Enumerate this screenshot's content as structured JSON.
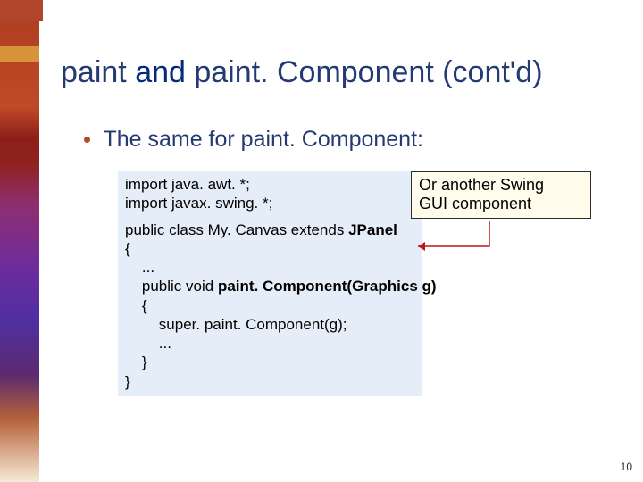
{
  "title": {
    "full": "paint and paint. Component (cont'd)",
    "prefix": "paint ",
    "and": "and",
    "rest": " paint. Component (cont'd)"
  },
  "bullet": "The same for paint. Component:",
  "code": {
    "l1": "import java. awt. *;",
    "l2": "import javax. swing. *;",
    "l3a": "public class My. Canvas extends ",
    "l3b": "JPanel",
    "l4": "{",
    "l5": "    ...",
    "l6a": "    public void ",
    "l6b": "paint. Component(Graphics g)",
    "l7": "    {",
    "l8": "        super. paint. Component(g);",
    "l9": "        ...",
    "l10": "    }",
    "l11": "}"
  },
  "note": {
    "line1": "Or another Swing",
    "line2": "GUI component"
  },
  "page": "10"
}
